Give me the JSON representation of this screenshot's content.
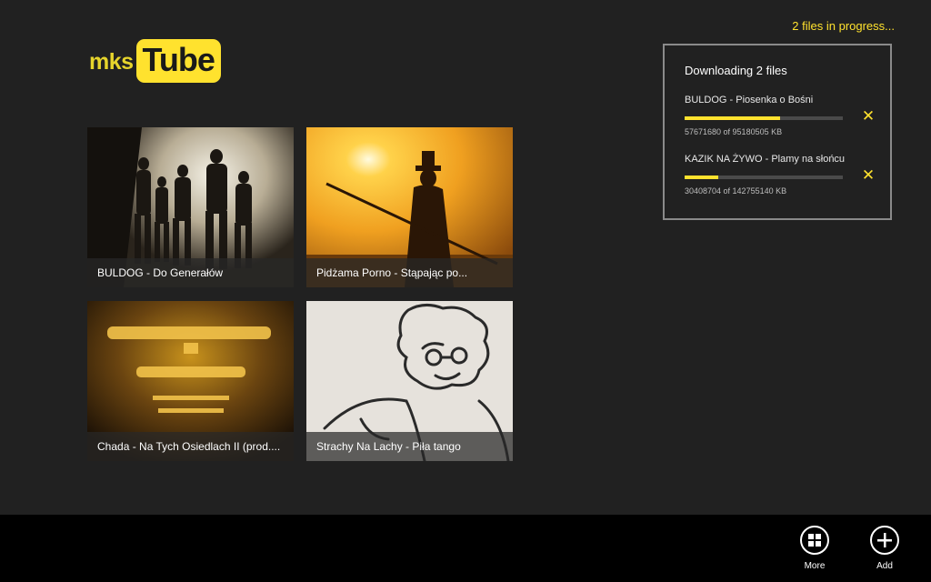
{
  "app": {
    "logo_prefix": "mks",
    "logo_main": "Tube"
  },
  "status": {
    "text": "2 files in progress..."
  },
  "downloads": {
    "title": "Downloading 2 files",
    "items": [
      {
        "name": "BULDOG - Piosenka o Bośni",
        "size_text": "57671680 of 95180505 KB",
        "progress": 0.606
      },
      {
        "name": "KAZIK NA ŻYWO - Plamy na słońcu",
        "size_text": "30408704 of 142755140 KB",
        "progress": 0.213
      }
    ],
    "cancel_icon": "close-icon"
  },
  "tiles": [
    {
      "caption": "BULDOG - Do Generałów"
    },
    {
      "caption": "Pidżama Porno - Stąpając po..."
    },
    {
      "caption": "Chada - Na Tych Osiedlach II (prod...."
    },
    {
      "caption": "Strachy Na Lachy - Piła tango"
    }
  ],
  "appbar": {
    "more_label": "More",
    "add_label": "Add"
  },
  "colors": {
    "accent": "#ffe22e",
    "background": "#212121",
    "appbar": "#000000"
  }
}
